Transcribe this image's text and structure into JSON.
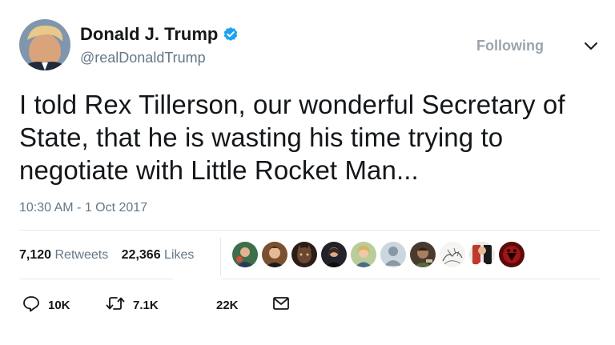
{
  "author": {
    "display_name": "Donald J. Trump",
    "handle": "@realDonaldTrump",
    "verified": true
  },
  "follow_button_label": "Following",
  "tweet_text": "I told Rex Tillerson, our wonderful Secretary of State, that he is wasting his time trying to negotiate with Little Rocket Man...",
  "timestamp": "10:30 AM - 1 Oct 2017",
  "stats": {
    "retweets_count": "7,120",
    "retweets_label": "Retweets",
    "likes_count": "22,366",
    "likes_label": "Likes"
  },
  "actions": {
    "reply_count": "10K",
    "retweet_count": "7.1K",
    "like_count": "22K"
  },
  "colors": {
    "text_primary": "#14171a",
    "text_secondary": "#657786",
    "verified_blue": "#1da1f2",
    "divider": "#e1e8ed"
  }
}
